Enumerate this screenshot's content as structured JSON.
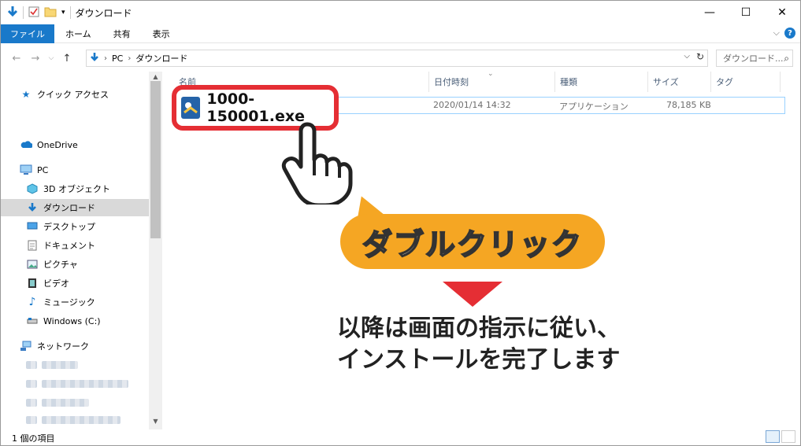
{
  "window": {
    "title": "ダウンロード",
    "controls": {
      "minimize": "—",
      "maximize": "☐",
      "close": "✕"
    }
  },
  "ribbon": {
    "tabs": [
      "ファイル",
      "ホーム",
      "共有",
      "表示"
    ],
    "expand": "⌵",
    "help": "?"
  },
  "address": {
    "back": "←",
    "forward": "→",
    "recent": "⌵",
    "up": "↑",
    "path": [
      "PC",
      "ダウンロード"
    ],
    "search_placeholder": "ダウンロード..."
  },
  "nav": {
    "quick_access": "クイック アクセス",
    "onedrive": "OneDrive",
    "pc": "PC",
    "items": [
      "3D オブジェクト",
      "ダウンロード",
      "デスクトップ",
      "ドキュメント",
      "ピクチャ",
      "ビデオ",
      "ミュージック",
      "Windows (C:)"
    ],
    "network": "ネットワーク"
  },
  "columns": [
    "名前",
    "日付時刻",
    "種類",
    "サイズ",
    "タグ"
  ],
  "files": [
    {
      "name": "1000-150001.exe",
      "date": "2020/01/14 14:32",
      "type": "アプリケーション",
      "size": "78,185 KB"
    }
  ],
  "status": {
    "count": "1 個の項目"
  },
  "callout": {
    "action": "ダブルクリック",
    "instruction_line1": "以降は画面の指示に従い、",
    "instruction_line2": "インストールを完了します"
  },
  "colors": {
    "accent": "#1979ca",
    "highlight": "#e52e34",
    "bubble": "#f5a623"
  }
}
